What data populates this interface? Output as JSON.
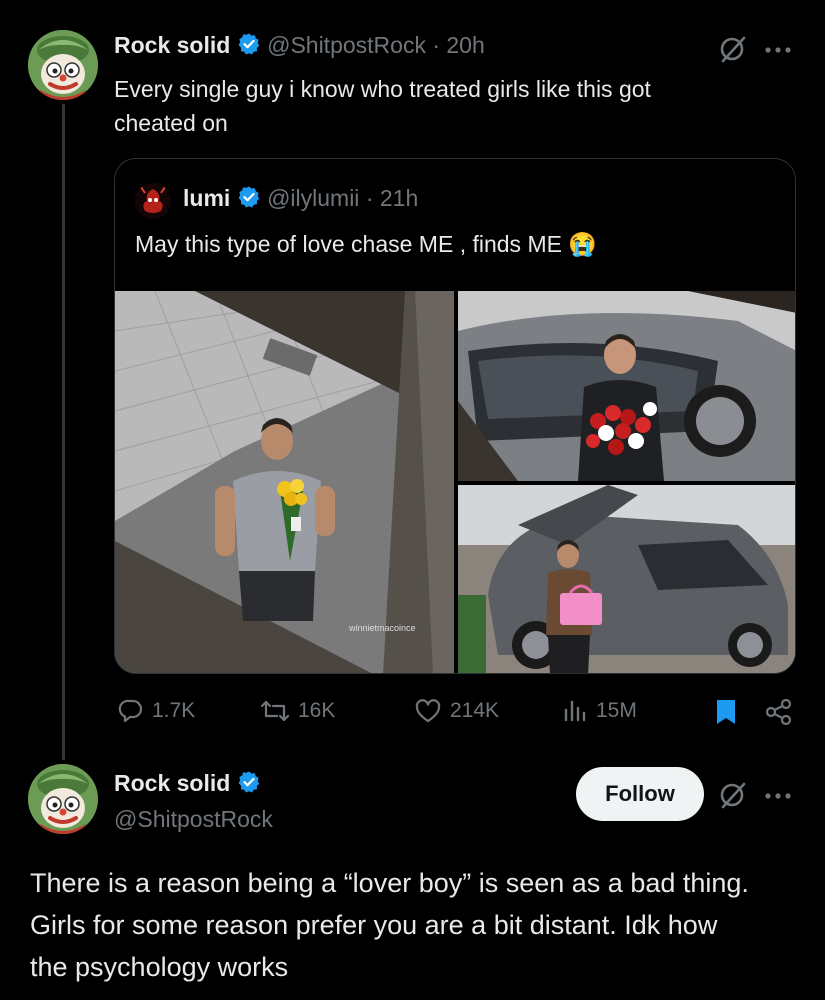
{
  "main_tweet": {
    "name": "Rock solid",
    "handle": "@ShitpostRock",
    "time": "· 20h",
    "text_line1": "Every single guy i know who treated girls like this got",
    "text_line2": "cheated on"
  },
  "quoted_tweet": {
    "name": "lumi",
    "handle": "@ilylumii",
    "time": "· 21h",
    "text": "May this type of love chase ME , finds ME",
    "emoji": "😭",
    "watermark": "winnietmacoince"
  },
  "actions": {
    "replies": "1.7K",
    "reposts": "16K",
    "likes": "214K",
    "views": "15M"
  },
  "reply": {
    "name": "Rock solid",
    "handle": "@ShitpostRock",
    "follow_label": "Follow",
    "text_line1": "There is a reason being a “lover boy” is seen as a bad thing.",
    "text_line2": "Girls for some reason prefer you are a bit distant. Idk how",
    "text_line3": "the psychology works"
  },
  "icons": {
    "verified": "verified-badge-icon",
    "grok": "grok-icon",
    "more": "more-icon",
    "reply": "reply-icon",
    "repost": "repost-icon",
    "like": "like-icon",
    "views": "views-icon",
    "bookmark": "bookmark-icon",
    "share": "share-icon"
  },
  "colors": {
    "background": "#000000",
    "text": "#e7e9ea",
    "muted": "#71767b",
    "verified": "#1d9bf0",
    "bookmark": "#1d9bf0"
  }
}
